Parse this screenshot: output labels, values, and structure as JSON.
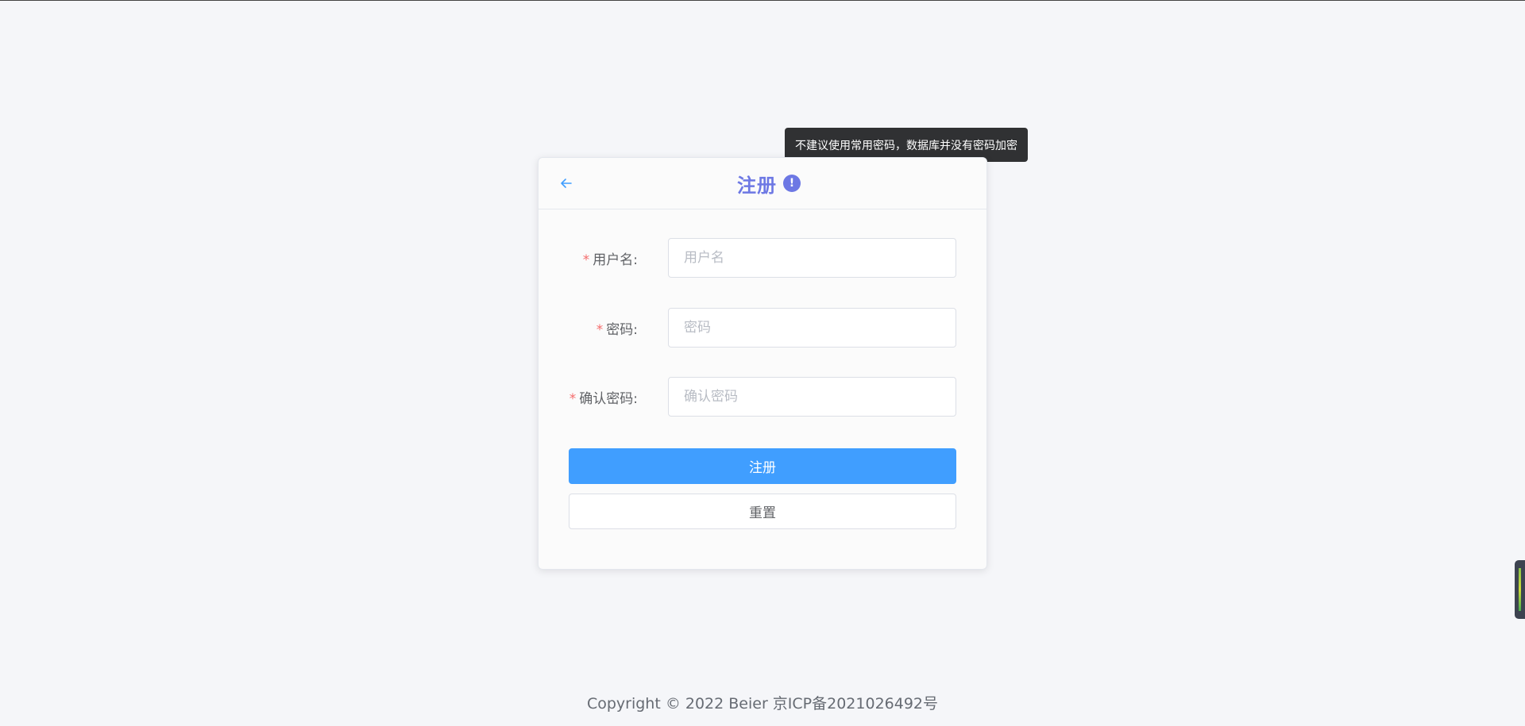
{
  "card": {
    "title": "注册",
    "info_tooltip": "不建议使用常用密码，数据库并没有密码加密"
  },
  "form": {
    "username": {
      "required_mark": "*",
      "label": "用户名:",
      "placeholder": "用户名",
      "value": ""
    },
    "password": {
      "required_mark": "*",
      "label": "密码:",
      "placeholder": "密码",
      "value": ""
    },
    "confirm_password": {
      "required_mark": "*",
      "label": "确认密码:",
      "placeholder": "确认密码",
      "value": ""
    },
    "submit_label": "注册",
    "reset_label": "重置"
  },
  "footer": {
    "copyright": "Copyright © 2022 Beier 京ICP备2021026492号"
  },
  "icons": {
    "back": "arrow-left-icon",
    "info": "exclamation-circle-icon"
  },
  "colors": {
    "title": "#6d78e4",
    "primary": "#409eff",
    "required": "#f56c6c",
    "tooltip_bg": "#303133"
  }
}
